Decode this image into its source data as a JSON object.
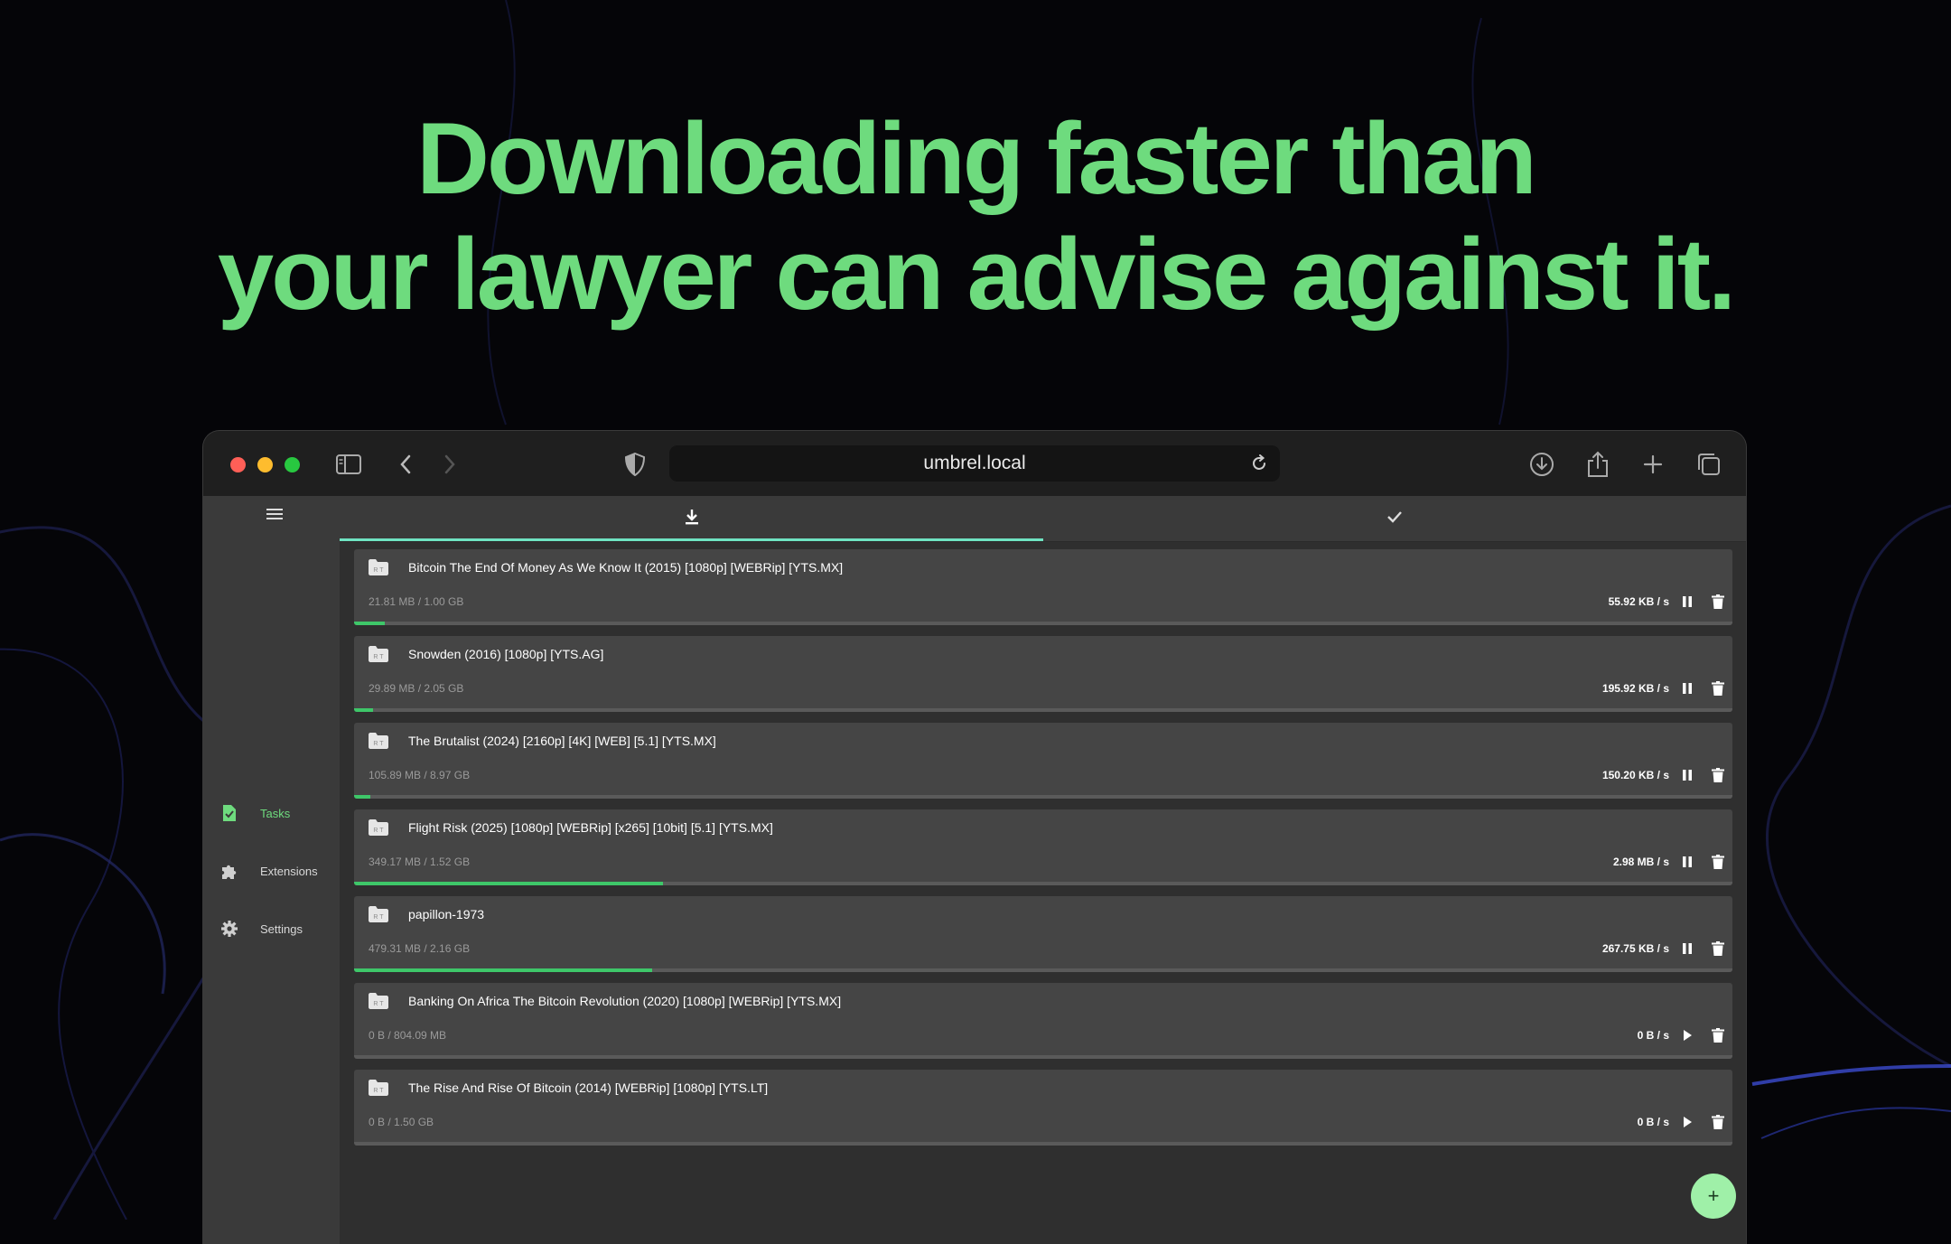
{
  "headline": {
    "line1": "Downloading faster than",
    "line2": "your lawyer can advise against it."
  },
  "browser": {
    "url": "umbrel.local",
    "traffic_lights": [
      "#ff5f57",
      "#febc2e",
      "#28c840"
    ],
    "icons": [
      "sidebar-toggle-icon",
      "back-icon",
      "forward-icon",
      "shield-icon",
      "reload-icon",
      "download-icon",
      "share-icon",
      "new-tab-icon",
      "tabs-overview-icon"
    ]
  },
  "sidebar": {
    "items": [
      {
        "label": "Tasks",
        "icon": "tasks-icon",
        "active": true
      },
      {
        "label": "Extensions",
        "icon": "puzzle-icon",
        "active": false
      },
      {
        "label": "Settings",
        "icon": "gear-icon",
        "active": false
      }
    ]
  },
  "tabs": [
    {
      "icon": "download-arrow-icon",
      "active": true
    },
    {
      "icon": "checkmark-icon",
      "active": false
    }
  ],
  "downloads": [
    {
      "name": "Bitcoin The End Of Money As We Know It (2015) [1080p] [WEBRip] [YTS.MX]",
      "size": "21.81 MB / 1.00 GB",
      "speed": "55.92 KB / s",
      "state": "downloading",
      "progress": 0.022
    },
    {
      "name": "Snowden (2016) [1080p] [YTS.AG]",
      "size": "29.89 MB / 2.05 GB",
      "speed": "195.92 KB / s",
      "state": "downloading",
      "progress": 0.014
    },
    {
      "name": "The Brutalist (2024) [2160p] [4K] [WEB] [5.1] [YTS.MX]",
      "size": "105.89 MB / 8.97 GB",
      "speed": "150.20 KB / s",
      "state": "downloading",
      "progress": 0.012
    },
    {
      "name": "Flight Risk (2025) [1080p] [WEBRip] [x265] [10bit] [5.1] [YTS.MX]",
      "size": "349.17 MB / 1.52 GB",
      "speed": "2.98 MB / s",
      "state": "downloading",
      "progress": 0.224
    },
    {
      "name": "papillon-1973",
      "size": "479.31 MB / 2.16 GB",
      "speed": "267.75 KB / s",
      "state": "downloading",
      "progress": 0.216
    },
    {
      "name": "Banking On Africa The Bitcoin Revolution (2020) [1080p] [WEBRip] [YTS.MX]",
      "size": "0 B / 804.09 MB",
      "speed": "0 B / s",
      "state": "paused",
      "progress": 0
    },
    {
      "name": "The Rise And Rise Of Bitcoin (2014) [WEBRip] [1080p] [YTS.LT]",
      "size": "0 B / 1.50 GB",
      "speed": "0 B / s",
      "state": "paused",
      "progress": 0
    }
  ],
  "fab": {
    "label": "+"
  },
  "colors": {
    "accent": "#6edb7e",
    "progress": "#3ec769",
    "tab_indicator": "#6fe3c2"
  }
}
